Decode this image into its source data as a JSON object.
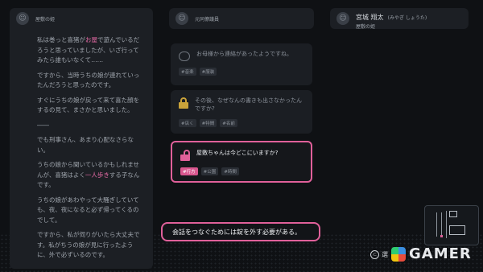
{
  "columns": {
    "left": {
      "name": "屋敷の姫"
    },
    "middle": {
      "name": "元同僚議員"
    },
    "right": {
      "name": "宮城 翔太",
      "reading": "(みやぎ しょうた)",
      "subtitle": "屋敷の姫"
    }
  },
  "left_text": [
    {
      "pre": "私は巻っと喜猪が",
      "hl": "お屋",
      "post": "で遊んでいるだろうと思っていましたが、いざ行ってみたら誰もいなくて……"
    },
    {
      "pre": "ですから、当時うちの娘が連れていったんだろうと思ったのです。",
      "hl": "",
      "post": ""
    },
    {
      "pre": "すぐにうちの娘が戻って来て喜た顔をするの見て、まさかと思いました。",
      "hl": "",
      "post": ""
    },
    {
      "pre": "――",
      "hl": "",
      "post": ""
    },
    {
      "pre": "でも刑事さん、あまり心配なさらない。",
      "hl": "",
      "post": ""
    },
    {
      "pre": "うちの娘から聞いているかもしれませんが、喜猪はよく",
      "hl": "一人歩き",
      "post": "する子なんです。"
    },
    {
      "pre": "うちの娘があわやって大騒ぎしていても、夜、夜になると必ず帰ってくるのでして。",
      "hl": "",
      "post": ""
    },
    {
      "pre": "ですから、私が伺りがいたら大丈夫です。私がちうの娘が見に行ったように、外で必ずいるのです。",
      "hl": "",
      "post": ""
    }
  ],
  "cards": [
    {
      "question": "お母様から連絡があったようですね。",
      "tags": [
        "#音楽",
        "#服装"
      ],
      "icon": "speech-bubble-icon",
      "selected": false
    },
    {
      "question": "その後、なぜなんの書きも出さなかったんですか?",
      "tags": [
        "#店く",
        "#特間",
        "#名前"
      ],
      "icon": "lock-icon",
      "selected": false
    },
    {
      "question": "屋敷ちゃんは今どこにいますか?",
      "tags": [
        "#行方",
        "#公園",
        "#時間"
      ],
      "active_tag": 0,
      "icon": "lock-open-icon",
      "selected": true
    }
  ],
  "dialog": {
    "text": "会話をつなぐためには錠を外す必要がある。"
  },
  "footer": {
    "button": "⊂",
    "label": "選"
  },
  "logo": {
    "text": "GAMER"
  },
  "colors": {
    "accent": "#e0609a",
    "panel": "#1c1f24",
    "bg": "#0f1114"
  }
}
